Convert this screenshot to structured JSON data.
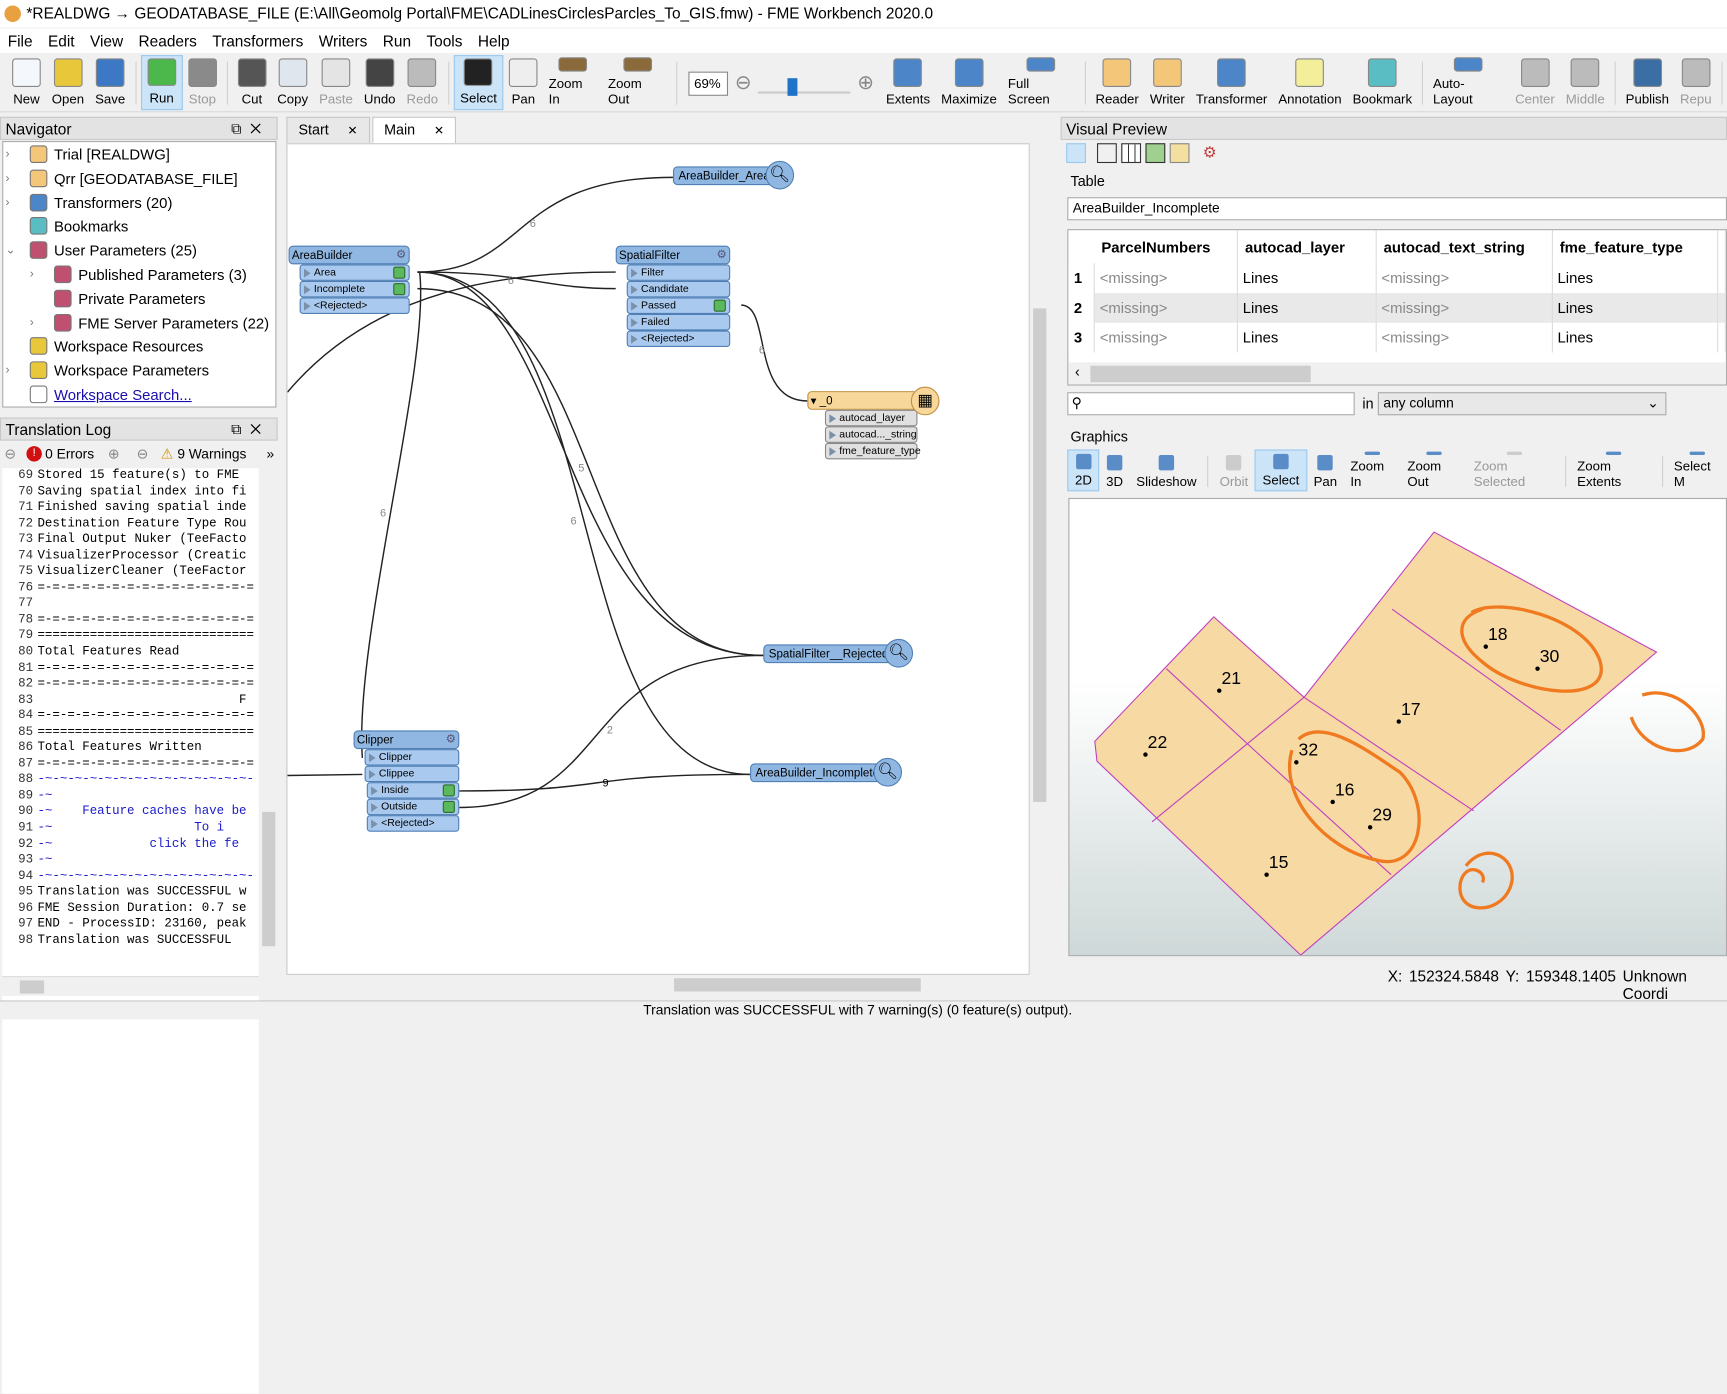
{
  "window": {
    "title": "*REALDWG → GEODATABASE_FILE (E:\\All\\Geomolg Portal\\FME\\CADLinesCirclesParcles_To_GIS.fmw) - FME Workbench 2020.0"
  },
  "menu": [
    "File",
    "Edit",
    "View",
    "Readers",
    "Transformers",
    "Writers",
    "Run",
    "Tools",
    "Help"
  ],
  "toolbar": {
    "groups": [
      [
        {
          "label": "New",
          "icon": "new-file-icon",
          "color": "#f4f7fb"
        },
        {
          "label": "Open",
          "icon": "folder-open-icon",
          "color": "#e8c83a"
        },
        {
          "label": "Save",
          "icon": "save-disk-icon",
          "color": "#3d78c4"
        }
      ],
      [
        {
          "label": "Run",
          "icon": "run-play-icon",
          "color": "#4cb84c",
          "active": true
        },
        {
          "label": "Stop",
          "icon": "stop-icon",
          "color": "#8a8a8a",
          "disabled": true
        }
      ],
      [
        {
          "label": "Cut",
          "icon": "scissors-icon",
          "color": "#555"
        },
        {
          "label": "Copy",
          "icon": "copy-icon",
          "color": "#dfe6ee"
        },
        {
          "label": "Paste",
          "icon": "paste-icon",
          "color": "#e4e4e4",
          "disabled": true
        },
        {
          "label": "Undo",
          "icon": "undo-icon",
          "color": "#444"
        },
        {
          "label": "Redo",
          "icon": "redo-icon",
          "color": "#bbb",
          "disabled": true
        }
      ],
      [
        {
          "label": "Select",
          "icon": "cursor-arrow-icon",
          "color": "#222",
          "active": true
        },
        {
          "label": "Pan",
          "icon": "hand-icon",
          "color": "#eee"
        },
        {
          "label": "Zoom In",
          "icon": "zoom-in-icon",
          "color": "#8a6a3a"
        },
        {
          "label": "Zoom Out",
          "icon": "zoom-out-icon",
          "color": "#8a6a3a"
        }
      ]
    ],
    "zoom_value": "69%",
    "zoom_level_percent": 69,
    "groups2": [
      [
        {
          "label": "Extents",
          "icon": "extents-icon",
          "color": "#4d86c8"
        },
        {
          "label": "Maximize",
          "icon": "maximize-icon",
          "color": "#4d86c8"
        },
        {
          "label": "Full Screen",
          "icon": "full-screen-icon",
          "color": "#4d86c8"
        }
      ],
      [
        {
          "label": "Reader",
          "icon": "add-reader-icon",
          "color": "#f4c67a"
        },
        {
          "label": "Writer",
          "icon": "add-writer-icon",
          "color": "#f4c67a"
        },
        {
          "label": "Transformer",
          "icon": "add-transformer-icon",
          "color": "#4d86c8"
        },
        {
          "label": "Annotation",
          "icon": "add-annotation-icon",
          "color": "#f2ee9a"
        },
        {
          "label": "Bookmark",
          "icon": "add-bookmark-icon",
          "color": "#5bbdc4"
        }
      ],
      [
        {
          "label": "Auto-Layout",
          "icon": "auto-layout-icon",
          "color": "#4d86c8"
        },
        {
          "label": "Center",
          "icon": "align-center-icon",
          "color": "#bbb",
          "disabled": true
        },
        {
          "label": "Middle",
          "icon": "align-middle-icon",
          "color": "#bbb",
          "disabled": true
        }
      ],
      [
        {
          "label": "Publish",
          "icon": "publish-icon",
          "color": "#3a6ea5"
        },
        {
          "label": "Repu",
          "icon": "republish-icon",
          "color": "#bbb",
          "disabled": true
        }
      ]
    ]
  },
  "navigator": {
    "title": "Navigator",
    "items": [
      {
        "label": "Trial [REALDWG]",
        "icon": "reader-db-icon",
        "color": "#f4c67a",
        "indent": 0,
        "expander": "›"
      },
      {
        "label": "Qrr [GEODATABASE_FILE]",
        "icon": "writer-db-icon",
        "color": "#f4c67a",
        "indent": 0,
        "expander": "›"
      },
      {
        "label": "Transformers (20)",
        "icon": "transformers-icon",
        "color": "#4d86c8",
        "indent": 0,
        "expander": "›"
      },
      {
        "label": "Bookmarks",
        "icon": "bookmark-icon",
        "color": "#5bbdc4",
        "indent": 0,
        "expander": ""
      },
      {
        "label": "User Parameters (25)",
        "icon": "parameters-gear-icon",
        "color": "#c05070",
        "indent": 0,
        "expander": "⌄"
      },
      {
        "label": "Published Parameters (3)",
        "icon": "parameters-gear-icon",
        "color": "#c05070",
        "indent": 1,
        "expander": "›"
      },
      {
        "label": "Private Parameters",
        "icon": "parameters-gear-icon",
        "color": "#c05070",
        "indent": 1,
        "expander": ""
      },
      {
        "label": "FME Server Parameters (22)",
        "icon": "parameters-gear-icon",
        "color": "#c05070",
        "indent": 1,
        "expander": "›"
      },
      {
        "label": "Workspace Resources",
        "icon": "resources-icon",
        "color": "#e8c83a",
        "indent": 0,
        "expander": ""
      },
      {
        "label": "Workspace Parameters",
        "icon": "workspace-gear-icon",
        "color": "#e8c83a",
        "indent": 0,
        "expander": "›"
      },
      {
        "label": "Workspace Search...",
        "icon": "search-icon",
        "color": "#fff",
        "indent": 0,
        "expander": "",
        "link": true
      }
    ]
  },
  "log": {
    "title": "Translation Log",
    "errors": "0 Errors",
    "warnings": "9 Warnings",
    "lines": [
      {
        "n": "69",
        "t": "Stored 15 feature(s) to FME"
      },
      {
        "n": "70",
        "t": "Saving spatial index into fi"
      },
      {
        "n": "71",
        "t": "Finished saving spatial inde"
      },
      {
        "n": "72",
        "t": "Destination Feature Type Rou"
      },
      {
        "n": "73",
        "t": "Final Output Nuker (TeeFacto"
      },
      {
        "n": "74",
        "t": "VisualizerProcessor (Creatic"
      },
      {
        "n": "75",
        "t": "VisualizerCleaner (TeeFactor"
      },
      {
        "n": "76",
        "t": "=-=-=-=-=-=-=-=-=-=-=-=-=-=-="
      },
      {
        "n": "77",
        "t": ""
      },
      {
        "n": "78",
        "t": "=-=-=-=-=-=-=-=-=-=-=-=-=-=-="
      },
      {
        "n": "79",
        "t": "============================="
      },
      {
        "n": "80",
        "t": "Total Features Read"
      },
      {
        "n": "81",
        "t": "=-=-=-=-=-=-=-=-=-=-=-=-=-=-="
      },
      {
        "n": "82",
        "t": "=-=-=-=-=-=-=-=-=-=-=-=-=-=-="
      },
      {
        "n": "83",
        "t": "                           F"
      },
      {
        "n": "84",
        "t": "=-=-=-=-=-=-=-=-=-=-=-=-=-=-="
      },
      {
        "n": "85",
        "t": "============================="
      },
      {
        "n": "86",
        "t": "Total Features Written"
      },
      {
        "n": "87",
        "t": "=-=-=-=-=-=-=-=-=-=-=-=-=-=-="
      },
      {
        "n": "88",
        "t": "-~-~-~-~-~-~-~-~-~-~-~-~-~-~-",
        "blue": true
      },
      {
        "n": "89",
        "t": "-~",
        "blue": true
      },
      {
        "n": "90",
        "t": "-~    Feature caches have be",
        "blue": true
      },
      {
        "n": "91",
        "t": "-~                   To i",
        "blue": true
      },
      {
        "n": "92",
        "t": "-~             click the fe",
        "blue": true
      },
      {
        "n": "93",
        "t": "-~",
        "blue": true
      },
      {
        "n": "94",
        "t": "-~-~-~-~-~-~-~-~-~-~-~-~-~-~-",
        "blue": true
      },
      {
        "n": "95",
        "t": "Translation was SUCCESSFUL w"
      },
      {
        "n": "96",
        "t": "FME Session Duration: 0.7 se"
      },
      {
        "n": "97",
        "t": "END - ProcessID: 23160, peak"
      },
      {
        "n": "98",
        "t": "Translation was SUCCESSFUL"
      }
    ]
  },
  "canvas": {
    "tabs": [
      {
        "label": "Start"
      },
      {
        "label": "Main",
        "active": true
      }
    ],
    "areabuilder": {
      "title": "AreaBuilder",
      "ports": [
        "Area",
        "Incomplete",
        "<Rejected>"
      ]
    },
    "spatialfilter": {
      "title": "SpatialFilter",
      "inputs": [
        "Filter",
        "Candidate"
      ],
      "outputs": [
        "Passed",
        "Failed",
        "<Rejected>"
      ]
    },
    "clipper": {
      "title": "Clipper",
      "inputs": [
        "Clipper",
        "Clippee"
      ],
      "outputs": [
        "Inside",
        "Outside",
        "<Rejected>"
      ]
    },
    "writer": {
      "title": "_0",
      "attrs": [
        "autocad_layer",
        "autocad..._string",
        "fme_feature_type"
      ]
    },
    "inspectors": [
      "AreaBuilder_Area",
      "SpatialFilter__Rejected_",
      "AreaBuilder_Incomplete"
    ],
    "link_counts": [
      "6",
      "6",
      "6",
      "6",
      "5",
      "6",
      "2",
      "9"
    ]
  },
  "preview": {
    "title": "Visual Preview",
    "table_label": "Table",
    "table_name": "AreaBuilder_Incomplete",
    "columns": [
      "ParcelNumbers",
      "autocad_layer",
      "autocad_text_string",
      "fme_feature_type"
    ],
    "rows": [
      {
        "n": "1",
        "cells": [
          "<missing>",
          "Lines",
          "<missing>",
          "Lines"
        ]
      },
      {
        "n": "2",
        "cells": [
          "<missing>",
          "Lines",
          "<missing>",
          "Lines"
        ]
      },
      {
        "n": "3",
        "cells": [
          "<missing>",
          "Lines",
          "<missing>",
          "Lines"
        ]
      }
    ],
    "search_placeholder": "",
    "in_label": "in",
    "column_filter": "any column",
    "graphics_label": "Graphics",
    "graphics_tools": [
      {
        "label": "2D",
        "icon": "2d-view-icon",
        "active": true
      },
      {
        "label": "3D",
        "icon": "3d-view-icon"
      },
      {
        "label": "Slideshow",
        "icon": "slideshow-icon"
      },
      {
        "label": "Orbit",
        "icon": "orbit-icon",
        "disabled": true
      },
      {
        "label": "Select",
        "icon": "select-info-icon",
        "active": true
      },
      {
        "label": "Pan",
        "icon": "hand-icon"
      },
      {
        "label": "Zoom In",
        "icon": "zoom-in-icon"
      },
      {
        "label": "Zoom Out",
        "icon": "zoom-out-icon"
      },
      {
        "label": "Zoom Selected",
        "icon": "zoom-selected-icon",
        "disabled": true
      },
      {
        "label": "Zoom Extents",
        "icon": "zoom-extents-icon"
      },
      {
        "label": "Select M",
        "icon": "select-mode-icon"
      }
    ],
    "parcel_labels": [
      "18",
      "30",
      "21",
      "17",
      "22",
      "32",
      "16",
      "29",
      "15"
    ],
    "x_label": "X:",
    "x_value": "152324.5848",
    "y_label": "Y:",
    "y_value": "159348.1405",
    "crs": "Unknown Coordi",
    "colors": {
      "parcel_fill": "#f7d9a4",
      "parcel_edge": "#c040c0",
      "annotation": "#f07a20"
    }
  },
  "status": "Translation was SUCCESSFUL with 7 warning(s) (0 feature(s) output)."
}
